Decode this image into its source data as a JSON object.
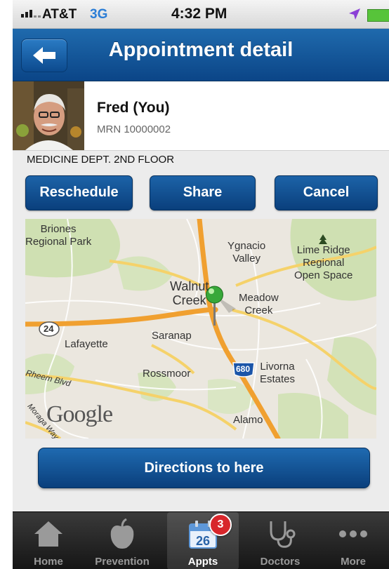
{
  "status_bar": {
    "carrier": "AT&T",
    "network": "3G",
    "time": "4:32 PM"
  },
  "nav": {
    "title": "Appointment detail"
  },
  "patient": {
    "name": "Fred (You)",
    "mrn": "MRN 10000002"
  },
  "location": "MEDICINE DEPT. 2ND FLOOR",
  "actions": {
    "reschedule": "Reschedule",
    "share": "Share",
    "cancel": "Cancel"
  },
  "map": {
    "labels": {
      "briones": "Briones\nRegional Park",
      "ygnacio": "Ygnacio\nValley",
      "lime_ridge": "Lime Ridge\nRegional\nOpen Space",
      "walnut_creek": "Walnut\nCreek",
      "meadow_creek": "Meadow\nCreek",
      "saranap": "Saranap",
      "lafayette": "Lafayette",
      "rossmoor": "Rossmoor",
      "livorna": "Livorna\nEstates",
      "alamo": "Alamo",
      "rheem": "Rheem Blvd",
      "moraga": "Moraga Way",
      "hwy24": "24",
      "hwy680": "680"
    },
    "logo": "Google"
  },
  "directions_label": "Directions to here",
  "tabs": [
    {
      "label": "Home",
      "icon": "home-icon"
    },
    {
      "label": "Prevention",
      "icon": "apple-icon"
    },
    {
      "label": "Appts",
      "icon": "calendar-icon",
      "calendar_day": "26",
      "badge": "3"
    },
    {
      "label": "Doctors",
      "icon": "stethoscope-icon"
    },
    {
      "label": "More",
      "icon": "more-icon"
    }
  ],
  "colors": {
    "nav_blue": "#0b4587",
    "button_blue": "#0a3f7c",
    "badge_red": "#d8262b",
    "tab_bar": "#151515"
  }
}
